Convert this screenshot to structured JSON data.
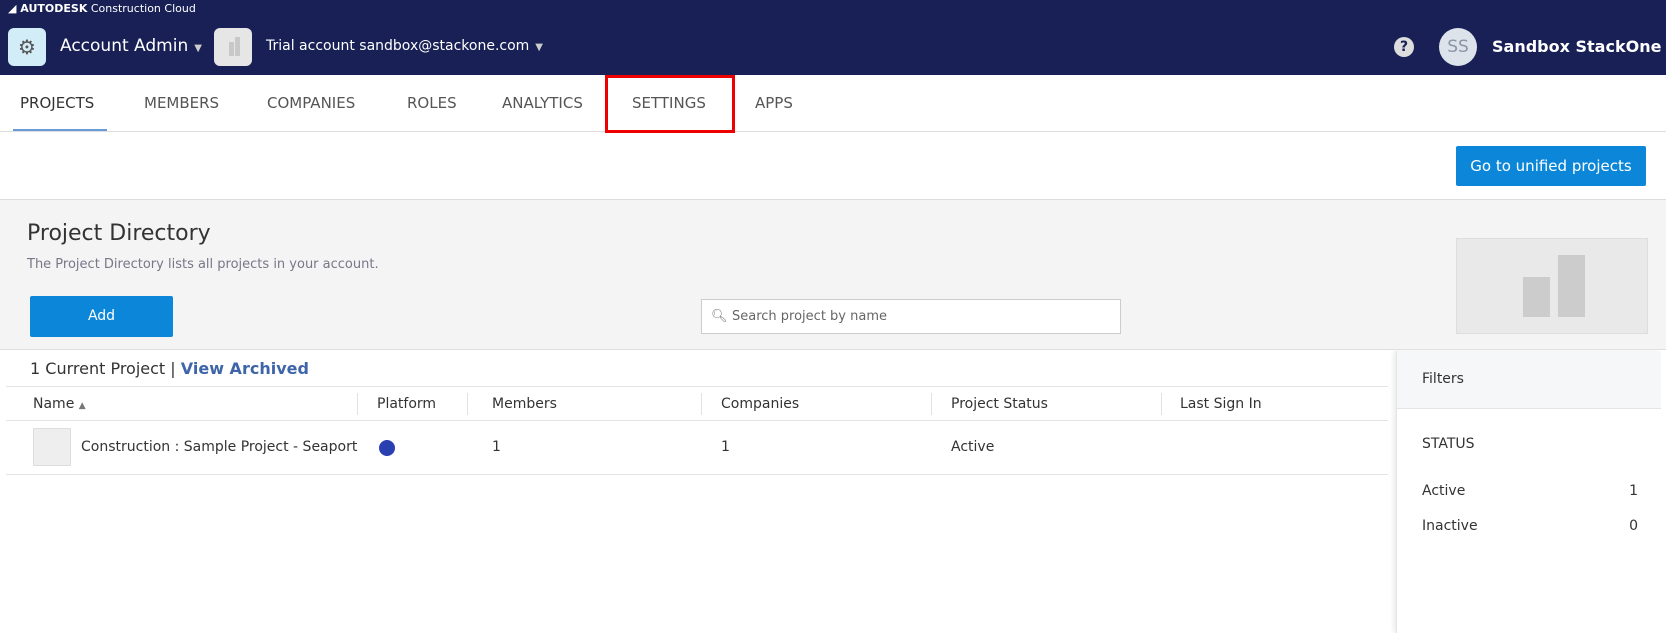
{
  "brand": {
    "logo": "AUTODESK",
    "product": "Construction Cloud"
  },
  "header": {
    "account_admin": "Account Admin",
    "trial_account": "Trial account sandbox@stackone.com",
    "help": "?",
    "avatar_initials": "SS",
    "user_name": "Sandbox StackOne"
  },
  "tabs": [
    "PROJECTS",
    "MEMBERS",
    "COMPANIES",
    "ROLES",
    "ANALYTICS",
    "SETTINGS",
    "APPS"
  ],
  "unified_button": "Go to unified projects",
  "directory": {
    "title": "Project Directory",
    "subtitle": "The Project Directory lists all projects in your account.",
    "add_label": "Add",
    "search_placeholder": "Search project by name"
  },
  "list": {
    "count": "1 Current Project",
    "divider": "|",
    "view_archived": "View Archived",
    "columns": [
      "Name",
      "Platform",
      "Members",
      "Companies",
      "Project Status",
      "Last Sign In"
    ],
    "rows": [
      {
        "name": "Construction : Sample Project - Seaport",
        "members": "1",
        "companies": "1",
        "status": "Active",
        "last_sign_in": ""
      }
    ]
  },
  "filters": {
    "title": "Filters",
    "section": "STATUS",
    "items": [
      {
        "label": "Active",
        "count": "1"
      },
      {
        "label": "Inactive",
        "count": "0"
      }
    ]
  },
  "colors": {
    "topbar": "#182056",
    "primary": "#0c86d8",
    "link": "#3d65a8",
    "highlight": "#ee0000"
  }
}
